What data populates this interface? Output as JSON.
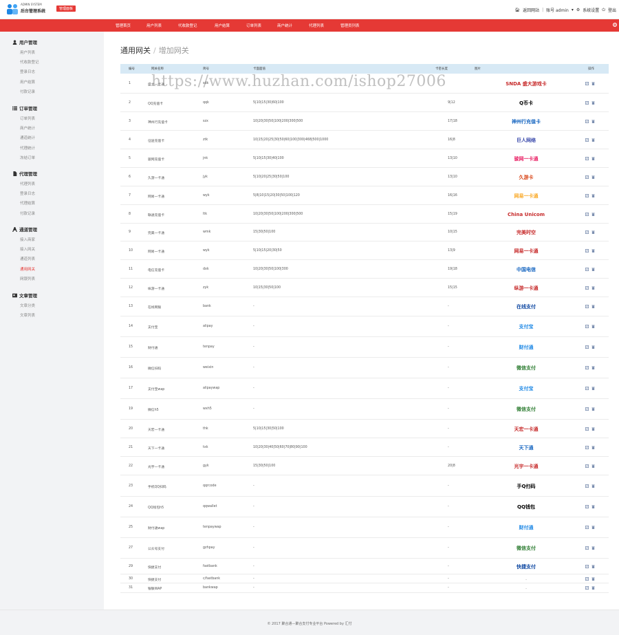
{
  "header": {
    "brand_small": "ADMIN SYSTEM",
    "brand": "后台管理系统",
    "badge": "管理面板",
    "home_link": "返回网站",
    "account": "账号 admin",
    "settings": "系统设置",
    "logout": "登出"
  },
  "nav": [
    "管理首页",
    "用户列表",
    "代收款登记",
    "用户结算",
    "订单列表",
    "商户统计",
    "代理列表",
    "管理员列表"
  ],
  "sidebar": [
    {
      "title": "用户管理",
      "icon": "user-icon",
      "items": [
        "用户列表",
        "代收款登记",
        "登录日志",
        "用户结算",
        "付款记录"
      ]
    },
    {
      "title": "订单管理",
      "icon": "list-icon",
      "items": [
        "订单列表",
        "商户统计",
        "通道统计",
        "代理统计",
        "冻结订单"
      ]
    },
    {
      "title": "代理管理",
      "icon": "document-icon",
      "items": [
        "代理列表",
        "登录日志",
        "代理结算",
        "付款记录"
      ]
    },
    {
      "title": "通道管理",
      "icon": "font-icon",
      "items": [
        "接入商家",
        "接入网关",
        "通道列表",
        "通用网关",
        "网银列表"
      ],
      "active": "通用网关"
    },
    {
      "title": "文章管理",
      "icon": "newspaper-icon",
      "items": [
        "文章分类",
        "文章列表"
      ]
    }
  ],
  "breadcrumb": {
    "root": "通用网关",
    "sep": "/",
    "current": "增加网关"
  },
  "table": {
    "headers": [
      "编号",
      "网关名称",
      "简号",
      "卡面面值",
      "卡密长度",
      "图片",
      "操作"
    ],
    "rows": [
      {
        "id": "1",
        "name": "盛大一卡通",
        "code": "sdk",
        "values": "",
        "len": "",
        "logo": "SNDA 盛大游戏卡",
        "color": "#c62828"
      },
      {
        "id": "2",
        "name": "QQ充值卡",
        "code": "qqk",
        "values": "5|10|15|30|60|100",
        "len": "9|12",
        "logo": "Q币卡",
        "color": "#000"
      },
      {
        "id": "3",
        "name": "神州行充值卡",
        "code": "szx",
        "values": "10|20|30|50|100|200|300|500",
        "len": "17|18",
        "logo": "神州行充值卡",
        "color": "#1565c0"
      },
      {
        "id": "4",
        "name": "征途充值卡",
        "code": "ztk",
        "values": "10|15|20|25|30|50|60|100|300|468|500|1000",
        "len": "16|8",
        "logo": "巨人网络",
        "color": "#3949ab"
      },
      {
        "id": "5",
        "name": "骏网充值卡",
        "code": "jnk",
        "values": "5|10|15|30|40|100",
        "len": "13|10",
        "logo": "骏网一卡通",
        "color": "#e91e63"
      },
      {
        "id": "6",
        "name": "久游一卡通",
        "code": "jyk",
        "values": "5|10|20|25|30|50|100",
        "len": "13|10",
        "logo": "久游卡",
        "color": "#d84315"
      },
      {
        "id": "7",
        "name": "网易一卡通",
        "code": "wyk",
        "values": "5|8|10|15|20|30|50|100|120",
        "len": "16|16",
        "logo": "网易一卡通",
        "color": "#f9a825"
      },
      {
        "id": "8",
        "name": "联通充值卡",
        "code": "ltk",
        "values": "10|20|30|50|100|200|300|500",
        "len": "15|19",
        "logo": "China Unicom",
        "color": "#c62828"
      },
      {
        "id": "9",
        "name": "完美一卡通",
        "code": "wmk",
        "values": "15|30|50|100",
        "len": "10|15",
        "logo": "完美时空",
        "color": "#c62828"
      },
      {
        "id": "10",
        "name": "网易一卡通",
        "code": "wyk",
        "values": "5|10|15|20|30|50",
        "len": "13|9",
        "logo": "网易一卡通",
        "color": "#c62828"
      },
      {
        "id": "11",
        "name": "电信充值卡",
        "code": "dxk",
        "values": "10|20|30|50|100|300",
        "len": "19|18",
        "logo": "中国电信",
        "color": "#1565c0"
      },
      {
        "id": "12",
        "name": "纵游一卡通",
        "code": "zyk",
        "values": "10|15|30|50|100",
        "len": "15|15",
        "logo": "纵游一卡通",
        "color": "#c62828"
      },
      {
        "id": "13",
        "name": "在线网银",
        "code": "bank",
        "values": "-",
        "len": "-",
        "logo": "在线支付",
        "color": "#0d47a1"
      },
      {
        "id": "14",
        "name": "支付宝",
        "code": "alipay",
        "values": "-",
        "len": "-",
        "logo": "支付宝",
        "color": "#1e88e5"
      },
      {
        "id": "15",
        "name": "财付通",
        "code": "tenpay",
        "values": "-",
        "len": "-",
        "logo": "财付通",
        "color": "#1e88e5"
      },
      {
        "id": "16",
        "name": "微信扫码",
        "code": "weixin",
        "values": "-",
        "len": "-",
        "logo": "微信支付",
        "color": "#2e7d32"
      },
      {
        "id": "17",
        "name": "支付宝wap",
        "code": "alipaywap",
        "values": "-",
        "len": "-",
        "logo": "支付宝",
        "color": "#1e88e5"
      },
      {
        "id": "19",
        "name": "微信h5",
        "code": "wxh5",
        "values": "-",
        "len": "-",
        "logo": "微信支付",
        "color": "#2e7d32"
      },
      {
        "id": "20",
        "name": "天宏一卡通",
        "code": "thk",
        "values": "5|10|15|30|50|100",
        "len": "-",
        "logo": "天宏一卡通",
        "color": "#c62828"
      },
      {
        "id": "21",
        "name": "天下一卡通",
        "code": "txk",
        "values": "10|20|30|40|50|60|70|80|90|100",
        "len": "-",
        "logo": "天下通",
        "color": "#1565c0"
      },
      {
        "id": "22",
        "name": "光宇一卡通",
        "code": "gyk",
        "values": "15|30|50|100",
        "len": "20|8",
        "logo": "光宇一卡通",
        "color": "#c62828"
      },
      {
        "id": "23",
        "name": "手机QQ扫码",
        "code": "qqrcode",
        "values": "-",
        "len": "-",
        "logo": "手Q扫码",
        "color": "#000"
      },
      {
        "id": "24",
        "name": "QQ钱包h5",
        "code": "qqwallet",
        "values": "-",
        "len": "-",
        "logo": "QQ钱包",
        "color": "#000"
      },
      {
        "id": "25",
        "name": "财付通wap",
        "code": "tenpaywap",
        "values": "-",
        "len": "-",
        "logo": "财付通",
        "color": "#1e88e5"
      },
      {
        "id": "27",
        "name": "公众号支付",
        "code": "gzhpay",
        "values": "-",
        "len": "-",
        "logo": "微信支付",
        "color": "#2e7d32"
      },
      {
        "id": "29",
        "name": "快捷支付",
        "code": "fastbank",
        "values": "-",
        "len": "-",
        "logo": "快捷支付",
        "color": "#0d47a1"
      },
      {
        "id": "30",
        "name": "快捷支付",
        "code": "c/fastbank",
        "values": "-",
        "len": "-",
        "logo": "-",
        "color": "#888"
      },
      {
        "id": "31",
        "name": "银联WAP",
        "code": "bankwap",
        "values": "-",
        "len": "-",
        "logo": "-",
        "color": "#888"
      }
    ]
  },
  "watermark": "https://www.huzhan.com/ishop27006",
  "footer": "© 2017 聚合通—聚合支付专业平台 Powered by 汇付",
  "colors": {
    "accent": "#e53935",
    "sidebar_bg": "#f2f3f5",
    "table_head": "#d7e9f5"
  }
}
